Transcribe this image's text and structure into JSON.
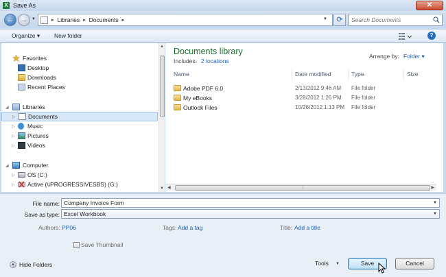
{
  "window": {
    "title": "Save As",
    "app_icon": "X",
    "close_glyph": "✕"
  },
  "nav": {
    "back_glyph": "←",
    "forward_glyph": "→"
  },
  "address": {
    "crumbs": [
      "Libraries",
      "Documents"
    ],
    "separator": "▸"
  },
  "search": {
    "placeholder": "Search Documents"
  },
  "toolbar": {
    "organize_label": "Organize ▾",
    "new_folder_label": "New folder",
    "help_glyph": "?"
  },
  "navpane": {
    "favorites": "Favorites",
    "desktop": "Desktop",
    "downloads": "Downloads",
    "recent_places": "Recent Places",
    "libraries": "Libraries",
    "documents": "Documents",
    "music": "Music",
    "pictures": "Pictures",
    "videos": "Videos",
    "computer": "Computer",
    "os_drive": "OS (C:)",
    "network_drive": "Active (\\\\PROGRESSIVESBS) (G:)"
  },
  "content": {
    "library_title": "Documents library",
    "includes_label": "Includes:",
    "includes_link": "2 locations",
    "arrange_label": "Arrange by:",
    "arrange_value": "Folder ▾",
    "columns": {
      "name": "Name",
      "date": "Date modified",
      "type": "Type",
      "size": "Size"
    },
    "files": [
      {
        "name": "Adobe PDF 6.0",
        "date": "2/13/2012 9:46 AM",
        "type": "File folder"
      },
      {
        "name": "My eBooks",
        "date": "3/28/2012 1:26 PM",
        "type": "File folder"
      },
      {
        "name": "Outlook Files",
        "date": "10/26/2012 1:13 PM",
        "type": "File folder"
      }
    ]
  },
  "form": {
    "file_name_label": "File name:",
    "file_name_value": "Company Invoice Form",
    "save_type_label": "Save as type:",
    "save_type_value": "Excel Workbook",
    "authors_label": "Authors:",
    "authors_value": "PP06",
    "tags_label": "Tags:",
    "tags_value": "Add a tag",
    "title_label": "Title:",
    "title_value": "Add a title",
    "thumbnail_label": "Save Thumbnail"
  },
  "footer": {
    "hide_folders": "Hide Folders",
    "tools": "Tools",
    "save": "Save",
    "cancel": "Cancel"
  },
  "colors": {
    "library_title": "#1b6d2b",
    "link": "#1a5fb4",
    "selection": "#d9e8f9"
  }
}
